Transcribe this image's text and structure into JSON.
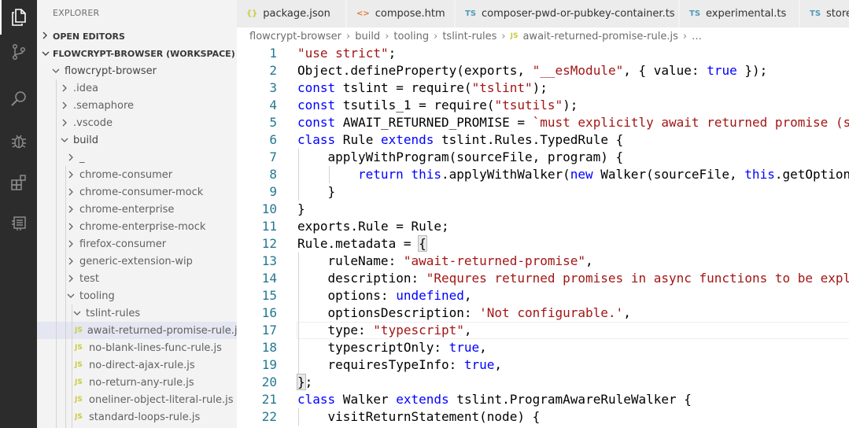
{
  "sidebar": {
    "title": "EXPLORER",
    "open_editors": "OPEN EDITORS",
    "workspace": "FLOWCRYPT-BROWSER (WORKSPACE)",
    "items": [
      {
        "label": "flowcrypt-browser",
        "type": "folder-open",
        "dark": true
      },
      {
        "label": ".idea",
        "type": "folder"
      },
      {
        "label": ".semaphore",
        "type": "folder"
      },
      {
        "label": ".vscode",
        "type": "folder"
      },
      {
        "label": "build",
        "type": "folder-open",
        "dark": true
      },
      {
        "label": "_",
        "type": "folder"
      },
      {
        "label": "chrome-consumer",
        "type": "folder"
      },
      {
        "label": "chrome-consumer-mock",
        "type": "folder"
      },
      {
        "label": "chrome-enterprise",
        "type": "folder"
      },
      {
        "label": "chrome-enterprise-mock",
        "type": "folder"
      },
      {
        "label": "firefox-consumer",
        "type": "folder"
      },
      {
        "label": "generic-extension-wip",
        "type": "folder"
      },
      {
        "label": "test",
        "type": "folder"
      },
      {
        "label": "tooling",
        "type": "folder-open"
      },
      {
        "label": "tslint-rules",
        "type": "folder-open"
      },
      {
        "label": "await-returned-promise-rule.js",
        "type": "js",
        "selected": true
      },
      {
        "label": "no-blank-lines-func-rule.js",
        "type": "js"
      },
      {
        "label": "no-direct-ajax-rule.js",
        "type": "js"
      },
      {
        "label": "no-return-any-rule.js",
        "type": "js"
      },
      {
        "label": "oneliner-object-literal-rule.js",
        "type": "js"
      },
      {
        "label": "standard-loops-rule.js",
        "type": "js"
      }
    ]
  },
  "tabs": [
    {
      "icon": "{}",
      "label": "package.json",
      "icon_color": "#cbcb41"
    },
    {
      "icon": "<>",
      "label": "compose.htm",
      "icon_color": "#e37933"
    },
    {
      "icon": "TS",
      "label": "composer-pwd-or-pubkey-container.ts",
      "icon_color": "#519aba"
    },
    {
      "icon": "TS",
      "label": "experimental.ts",
      "icon_color": "#519aba"
    },
    {
      "icon": "TS",
      "label": "store",
      "icon_color": "#519aba"
    }
  ],
  "breadcrumb": {
    "parts": [
      "flowcrypt-browser",
      "build",
      "tooling",
      "tslint-rules"
    ],
    "file_icon": "JS",
    "file": "await-returned-promise-rule.js",
    "trail": "…"
  },
  "editor": {
    "lines": [
      {
        "n": "1",
        "indent": 0,
        "tokens": [
          [
            "str",
            "\"use strict\""
          ],
          [
            "",
            ";"
          ]
        ]
      },
      {
        "n": "2",
        "indent": 0,
        "tokens": [
          [
            "",
            "Object.defineProperty(exports, "
          ],
          [
            "str",
            "\"__esModule\""
          ],
          [
            "",
            ", { value: "
          ],
          [
            "kw",
            "true"
          ],
          [
            "",
            " });"
          ]
        ]
      },
      {
        "n": "3",
        "indent": 0,
        "tokens": [
          [
            "kw",
            "const"
          ],
          [
            "",
            " tslint = require("
          ],
          [
            "str",
            "\"tslint\""
          ],
          [
            "",
            ");"
          ]
        ]
      },
      {
        "n": "4",
        "indent": 0,
        "tokens": [
          [
            "kw",
            "const"
          ],
          [
            "",
            " tsutils_1 = require("
          ],
          [
            "str",
            "\"tsutils\""
          ],
          [
            "",
            ");"
          ]
        ]
      },
      {
        "n": "5",
        "indent": 0,
        "tokens": [
          [
            "kw",
            "const"
          ],
          [
            "",
            " AWAIT_RETURNED_PROMISE = "
          ],
          [
            "str",
            "`must explicitly await returned promise (s"
          ]
        ]
      },
      {
        "n": "6",
        "indent": 0,
        "tokens": [
          [
            "kw",
            "class"
          ],
          [
            "",
            " Rule "
          ],
          [
            "kw",
            "extends"
          ],
          [
            "",
            " tslint.Rules.TypedRule {"
          ]
        ]
      },
      {
        "n": "7",
        "indent": 1,
        "tokens": [
          [
            "",
            "applyWithProgram(sourceFile, program) {"
          ]
        ]
      },
      {
        "n": "8",
        "indent": 2,
        "tokens": [
          [
            "kw",
            "return"
          ],
          [
            "",
            " "
          ],
          [
            "kw",
            "this"
          ],
          [
            "",
            ".applyWithWalker("
          ],
          [
            "kw",
            "new"
          ],
          [
            "",
            " Walker(sourceFile, "
          ],
          [
            "kw",
            "this"
          ],
          [
            "",
            ".getOption"
          ]
        ]
      },
      {
        "n": "9",
        "indent": 1,
        "tokens": [
          [
            "",
            "}"
          ]
        ]
      },
      {
        "n": "10",
        "indent": 0,
        "tokens": [
          [
            "",
            "}"
          ]
        ]
      },
      {
        "n": "11",
        "indent": 0,
        "tokens": [
          [
            "",
            "exports.Rule = Rule;"
          ]
        ]
      },
      {
        "n": "12",
        "indent": 0,
        "tokens": [
          [
            "",
            "Rule.metadata = "
          ],
          [
            "match",
            "{"
          ]
        ]
      },
      {
        "n": "13",
        "indent": 1,
        "tokens": [
          [
            "",
            "ruleName: "
          ],
          [
            "str",
            "\"await-returned-promise\""
          ],
          [
            "",
            ","
          ]
        ]
      },
      {
        "n": "14",
        "indent": 1,
        "tokens": [
          [
            "",
            "description: "
          ],
          [
            "str",
            "\"Requres returned promises in async functions to be expl"
          ]
        ]
      },
      {
        "n": "15",
        "indent": 1,
        "tokens": [
          [
            "",
            "options: "
          ],
          [
            "kw",
            "undefined"
          ],
          [
            "",
            ","
          ]
        ]
      },
      {
        "n": "16",
        "indent": 1,
        "tokens": [
          [
            "",
            "optionsDescription: "
          ],
          [
            "str",
            "'Not configurable.'"
          ],
          [
            "",
            ","
          ]
        ]
      },
      {
        "n": "17",
        "indent": 1,
        "current": true,
        "tokens": [
          [
            "",
            "type: "
          ],
          [
            "str",
            "\"typescript\""
          ],
          [
            "",
            ","
          ]
        ]
      },
      {
        "n": "18",
        "indent": 1,
        "tokens": [
          [
            "",
            "typescriptOnly: "
          ],
          [
            "kw",
            "true"
          ],
          [
            "",
            ","
          ]
        ]
      },
      {
        "n": "19",
        "indent": 1,
        "tokens": [
          [
            "",
            "requiresTypeInfo: "
          ],
          [
            "kw",
            "true"
          ],
          [
            "",
            ","
          ]
        ]
      },
      {
        "n": "20",
        "indent": 0,
        "tokens": [
          [
            "match",
            "}"
          ],
          [
            "",
            ";"
          ]
        ]
      },
      {
        "n": "21",
        "indent": 0,
        "tokens": [
          [
            "kw",
            "class"
          ],
          [
            "",
            " Walker "
          ],
          [
            "kw",
            "extends"
          ],
          [
            "",
            " tslint.ProgramAwareRuleWalker {"
          ]
        ]
      },
      {
        "n": "22",
        "indent": 1,
        "tokens": [
          [
            "",
            "visitReturnStatement(node) {"
          ]
        ]
      }
    ]
  }
}
